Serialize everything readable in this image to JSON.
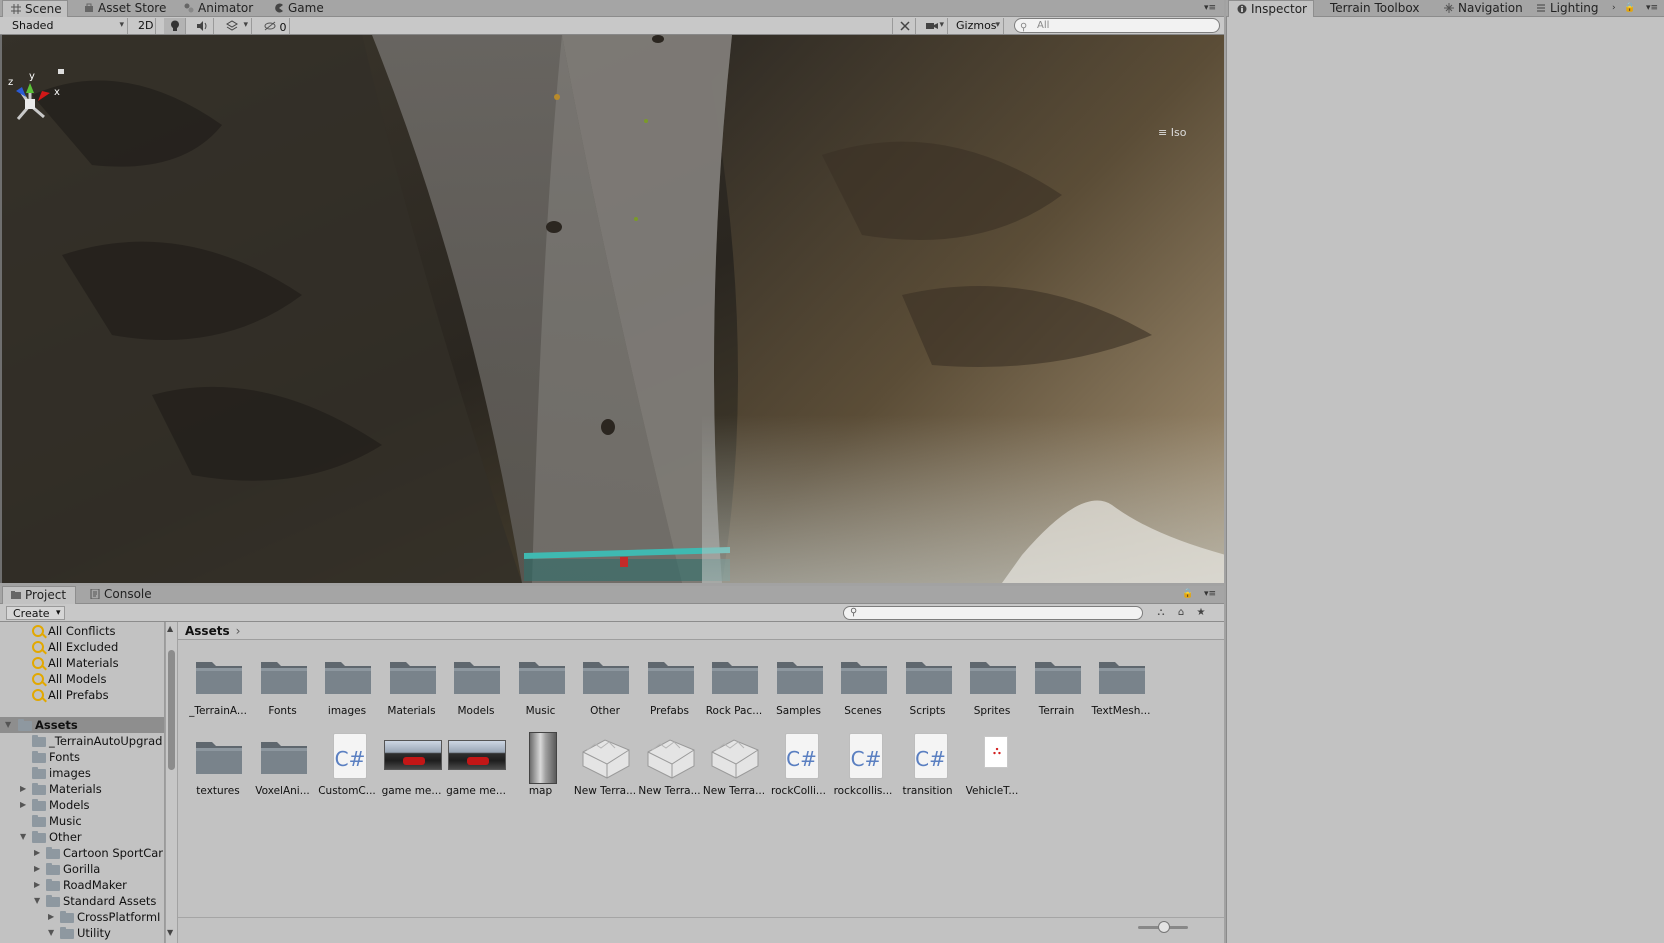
{
  "top_tabs": {
    "scene": "Scene",
    "asset_store": "Asset Store",
    "animator": "Animator",
    "game": "Game",
    "inspector": "Inspector",
    "terrain_toolbox": "Terrain Toolbox",
    "navigation": "Navigation",
    "lighting": "Lighting"
  },
  "scene_toolbar": {
    "shading_mode": "Shaded",
    "mode_2d": "2D",
    "hidden_count": "0",
    "gizmos": "Gizmos",
    "search_placeholder": "All"
  },
  "scene_view": {
    "projection": "Iso",
    "axes": {
      "x": "x",
      "y": "y",
      "z": "z"
    }
  },
  "project_tabs": {
    "project": "Project",
    "console": "Console"
  },
  "project_toolbar": {
    "create": "Create"
  },
  "tree": {
    "favorites": [
      "All Conflicts",
      "All Excluded",
      "All Materials",
      "All Models",
      "All Prefabs"
    ],
    "root": "Assets",
    "items": [
      "_TerrainAutoUpgrad",
      "Fonts",
      "images",
      "Materials",
      "Models",
      "Music",
      "Other",
      "Cartoon SportCar",
      "Gorilla",
      "RoadMaker",
      "Standard Assets",
      "CrossPlatformI",
      "Utility"
    ]
  },
  "breadcrumb": "Assets",
  "assets_row1": [
    "_TerrainA...",
    "Fonts",
    "images",
    "Materials",
    "Models",
    "Music",
    "Other",
    "Prefabs",
    "Rock Pac...",
    "Samples",
    "Scenes",
    "Scripts",
    "Sprites",
    "Terrain",
    "TextMesh..."
  ],
  "assets_row2": [
    "textures",
    "VoxelAni...",
    "CustomC...",
    "game me...",
    "game me...",
    "map",
    "New Terra...",
    "New Terra...",
    "New Terra...",
    "rockColli...",
    "rockcollis...",
    "transition",
    "VehicleT..."
  ],
  "icons": {
    "cs_glyph": "C#",
    "pdf_glyph": "PDF"
  },
  "colors": {
    "panel_bg": "#c2c2c2",
    "folder": "#6d757c",
    "cs_blue": "#5a7fc1",
    "gizmo_x": "#d01818",
    "gizmo_y": "#5bc238",
    "gizmo_z": "#2a5bd6"
  }
}
